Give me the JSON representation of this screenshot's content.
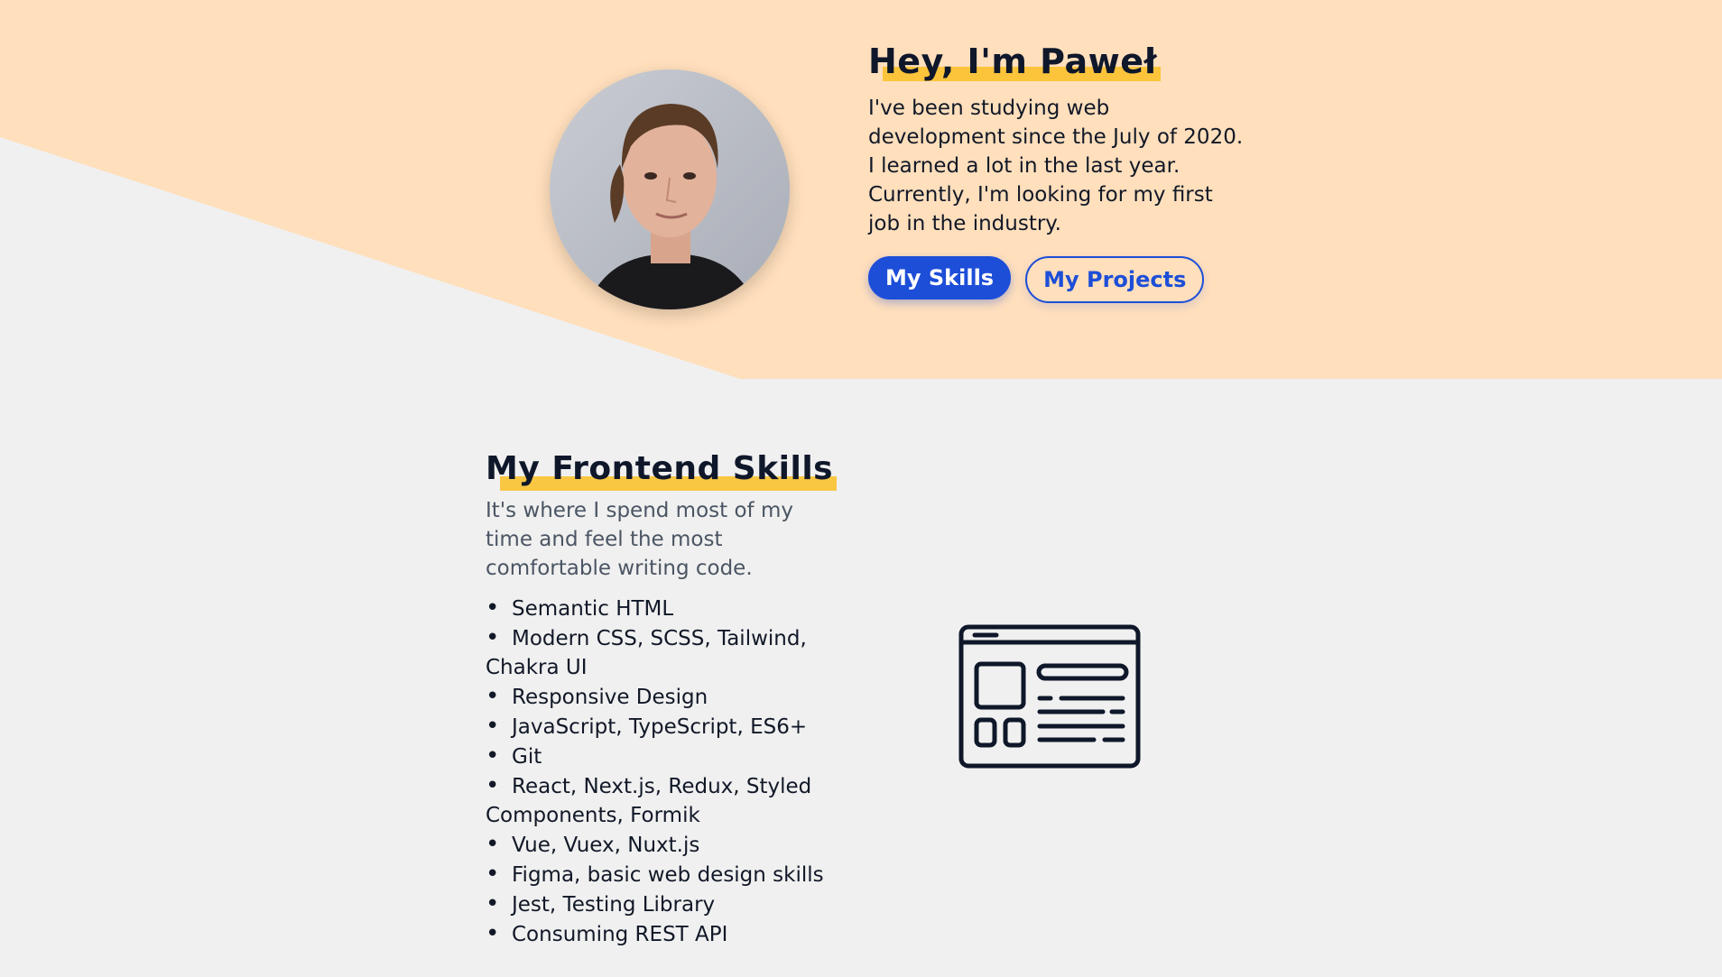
{
  "hero": {
    "title": "Hey, I'm Paweł",
    "description_line1": "I've been studying web development since the July of 2020. I learned a lot in the last year.",
    "description_line2": "Currently, I'm looking for my first job in the industry.",
    "skills_button": "My Skills",
    "projects_button": "My Projects"
  },
  "frontend": {
    "title": "My Frontend Skills",
    "description": "It's where I spend most of my time and feel the most comfortable writing code.",
    "items": [
      "Semantic HTML",
      "Modern CSS, SCSS, Tailwind, Chakra UI",
      "Responsive Design",
      "JavaScript, TypeScript, ES6+",
      "Git",
      "React, Next.js, Redux, Styled Components, Formik",
      "Vue, Vuex, Nuxt.js",
      "Figma, basic web design skills",
      "Jest, Testing Library",
      "Consuming REST API"
    ],
    "icon": "web-layout-icon"
  },
  "colors": {
    "hero_background": "#ffdfbc",
    "page_background": "#f0f0f0",
    "accent": "#1d4ed8",
    "highlight": "#fbbf24"
  }
}
